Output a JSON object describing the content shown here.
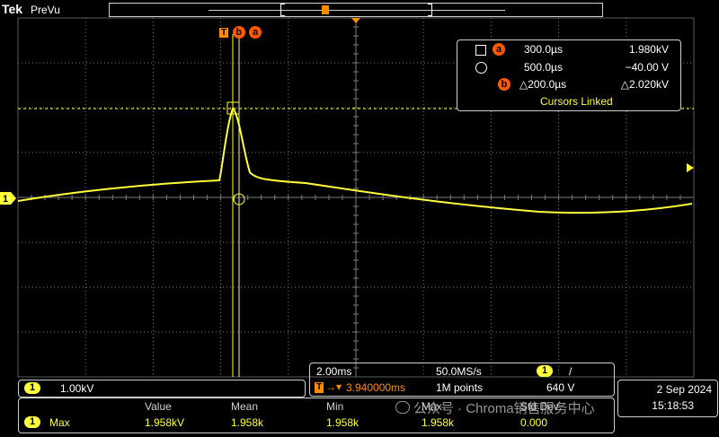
{
  "brand": {
    "logo": "Tek",
    "mode": "PreVu"
  },
  "colors": {
    "trace": "#ffff3a",
    "cursor_marker": "#ff5a00",
    "grid": "#7a7a7a"
  },
  "trigger": {
    "marker": "T"
  },
  "cursor_labels": {
    "a": "a",
    "b": "b"
  },
  "cursor_readout": {
    "row_a": {
      "time": "300.0µs",
      "value": "1.980kV"
    },
    "row_o": {
      "time": "500.0µs",
      "value": "−40.00 V"
    },
    "row_b": {
      "time": "△200.0µs",
      "value": "△2.020kV"
    },
    "linked": "Cursors Linked"
  },
  "channel": {
    "id": "1",
    "scale": "1.00kV"
  },
  "horizontal": {
    "time_per_div": "2.00ms",
    "sample_rate": "50.0MS/s",
    "trigger_position": "3.940000ms",
    "record_length": "1M points",
    "trigger_channel": "1",
    "trigger_slope": "/",
    "trigger_level": "640 V"
  },
  "date": {
    "day": "2 Sep  2024",
    "time": "15:18:53"
  },
  "measurements": {
    "headers": [
      "Value",
      "Mean",
      "Min",
      "Max",
      "Std Dev"
    ],
    "rows": [
      {
        "channel": "1",
        "name": "Max",
        "values": [
          "1.958kV",
          "1.958k",
          "1.958k",
          "1.958k",
          "0.000"
        ]
      }
    ]
  },
  "watermark": "公众号 · Chroma销售服务中心"
}
